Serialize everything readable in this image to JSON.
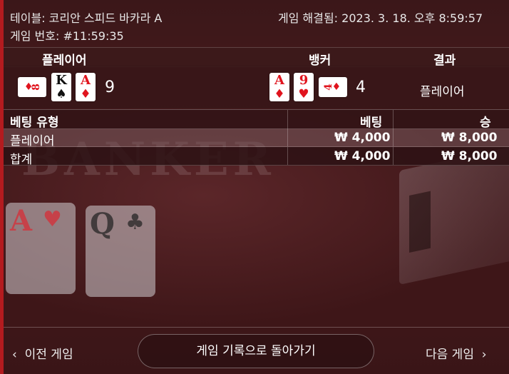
{
  "header": {
    "table_label": "테이블: 코리안 스피드 바카라 A",
    "game_number": "게임 번호: #11:59:35",
    "settled": "게임 해결됨: 2023. 3. 18. 오후 8:59:57"
  },
  "hands": {
    "player_header": "플레이어",
    "banker_header": "뱅커",
    "result_header": "결과",
    "player_cards": [
      {
        "rank": "8",
        "suit": "♦",
        "color": "red",
        "orientation": "sideways"
      },
      {
        "rank": "K",
        "suit": "♠",
        "color": "black",
        "orientation": "upright"
      },
      {
        "rank": "A",
        "suit": "♦",
        "color": "red",
        "orientation": "upright"
      }
    ],
    "player_score": "9",
    "banker_cards": [
      {
        "rank": "A",
        "suit": "♦",
        "color": "red",
        "orientation": "upright"
      },
      {
        "rank": "9",
        "suit": "♥",
        "color": "red",
        "orientation": "upright"
      },
      {
        "rank": "4",
        "suit": "♦",
        "color": "red",
        "orientation": "sideways"
      }
    ],
    "banker_score": "4",
    "result": "플레이어"
  },
  "bets": {
    "columns": [
      "베팅 유형",
      "베팅",
      "승"
    ],
    "rows": [
      {
        "type": "플레이어",
        "bet": "₩ 4,000",
        "win": "₩ 8,000"
      },
      {
        "type": "합계",
        "bet": "₩ 4,000",
        "win": "₩ 8,000"
      }
    ]
  },
  "footer": {
    "prev": "이전 게임",
    "back": "게임 기록으로 돌아가기",
    "next": "다음 게임"
  },
  "background": {
    "word": "BANKER",
    "cards": [
      {
        "rank": "A",
        "suit": "♥"
      },
      {
        "rank": "Q",
        "suit": "♣"
      }
    ]
  },
  "colors": {
    "accent_red": "#b31b1f",
    "card_red": "#e0141e"
  }
}
